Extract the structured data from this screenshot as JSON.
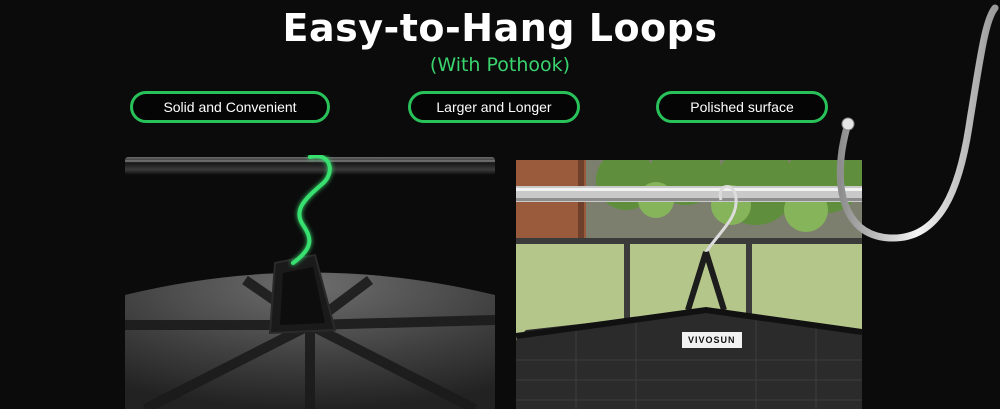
{
  "header": {
    "title": "Easy-to-Hang Loops",
    "subtitle": "(With Pothook)"
  },
  "features": [
    {
      "label": "Solid and Convenient"
    },
    {
      "label": "Larger and Longer"
    },
    {
      "label": "Polished surface"
    }
  ],
  "photo": {
    "brand_label": "VIVOSUN"
  },
  "colors": {
    "background": "#0b0b0b",
    "accent_green": "#29c25a",
    "subtitle_green": "#3ad46e"
  }
}
